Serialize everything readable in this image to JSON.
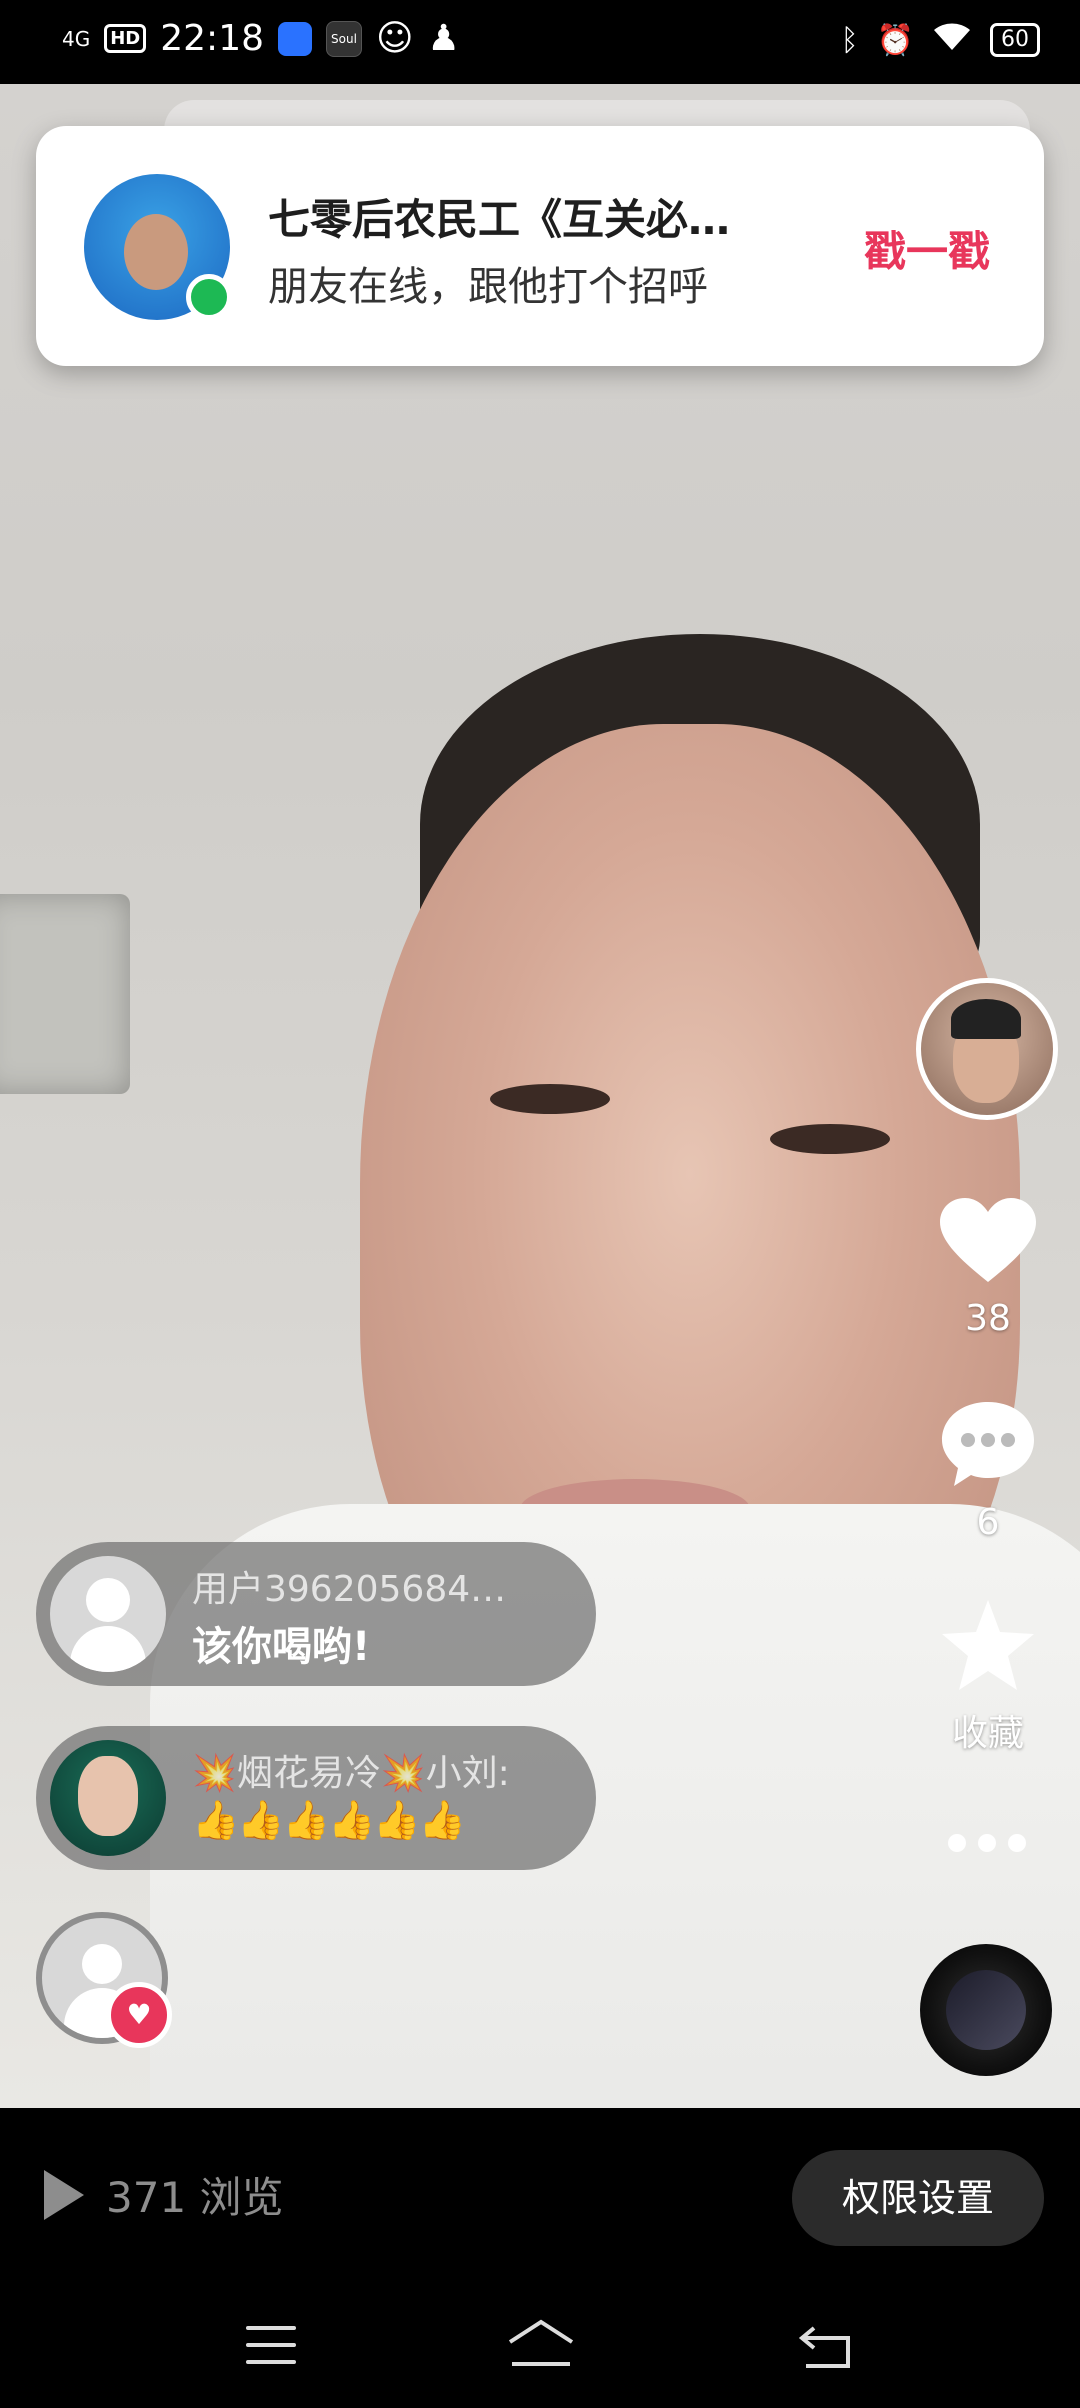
{
  "status_bar": {
    "network": "4G",
    "hd": "HD",
    "time": "22:18",
    "app2_label": "Soul",
    "battery": "60",
    "icons": [
      "signal-icon",
      "hd-icon",
      "app-icon",
      "soul-app-icon",
      "message-bubble-icon",
      "qq-icon",
      "bluetooth-icon",
      "alarm-icon",
      "wifi-icon",
      "battery-icon"
    ]
  },
  "notification": {
    "title": "七零后农民工《互关必…",
    "subtitle": "朋友在线，跟他打个招呼",
    "action": "戳一戳",
    "action_color": "#e8365b",
    "online_color": "#1db954"
  },
  "rail": {
    "likes": "38",
    "comments": "6",
    "favorite_label": "收藏"
  },
  "comments": [
    {
      "name": "用户396205684…",
      "text": "该你喝哟!"
    },
    {
      "name": "💥烟花易冷💥小刘:",
      "text": "👍👍👍👍👍👍"
    }
  ],
  "bottom": {
    "views": "371 浏览",
    "permission_button": "权限设置"
  }
}
